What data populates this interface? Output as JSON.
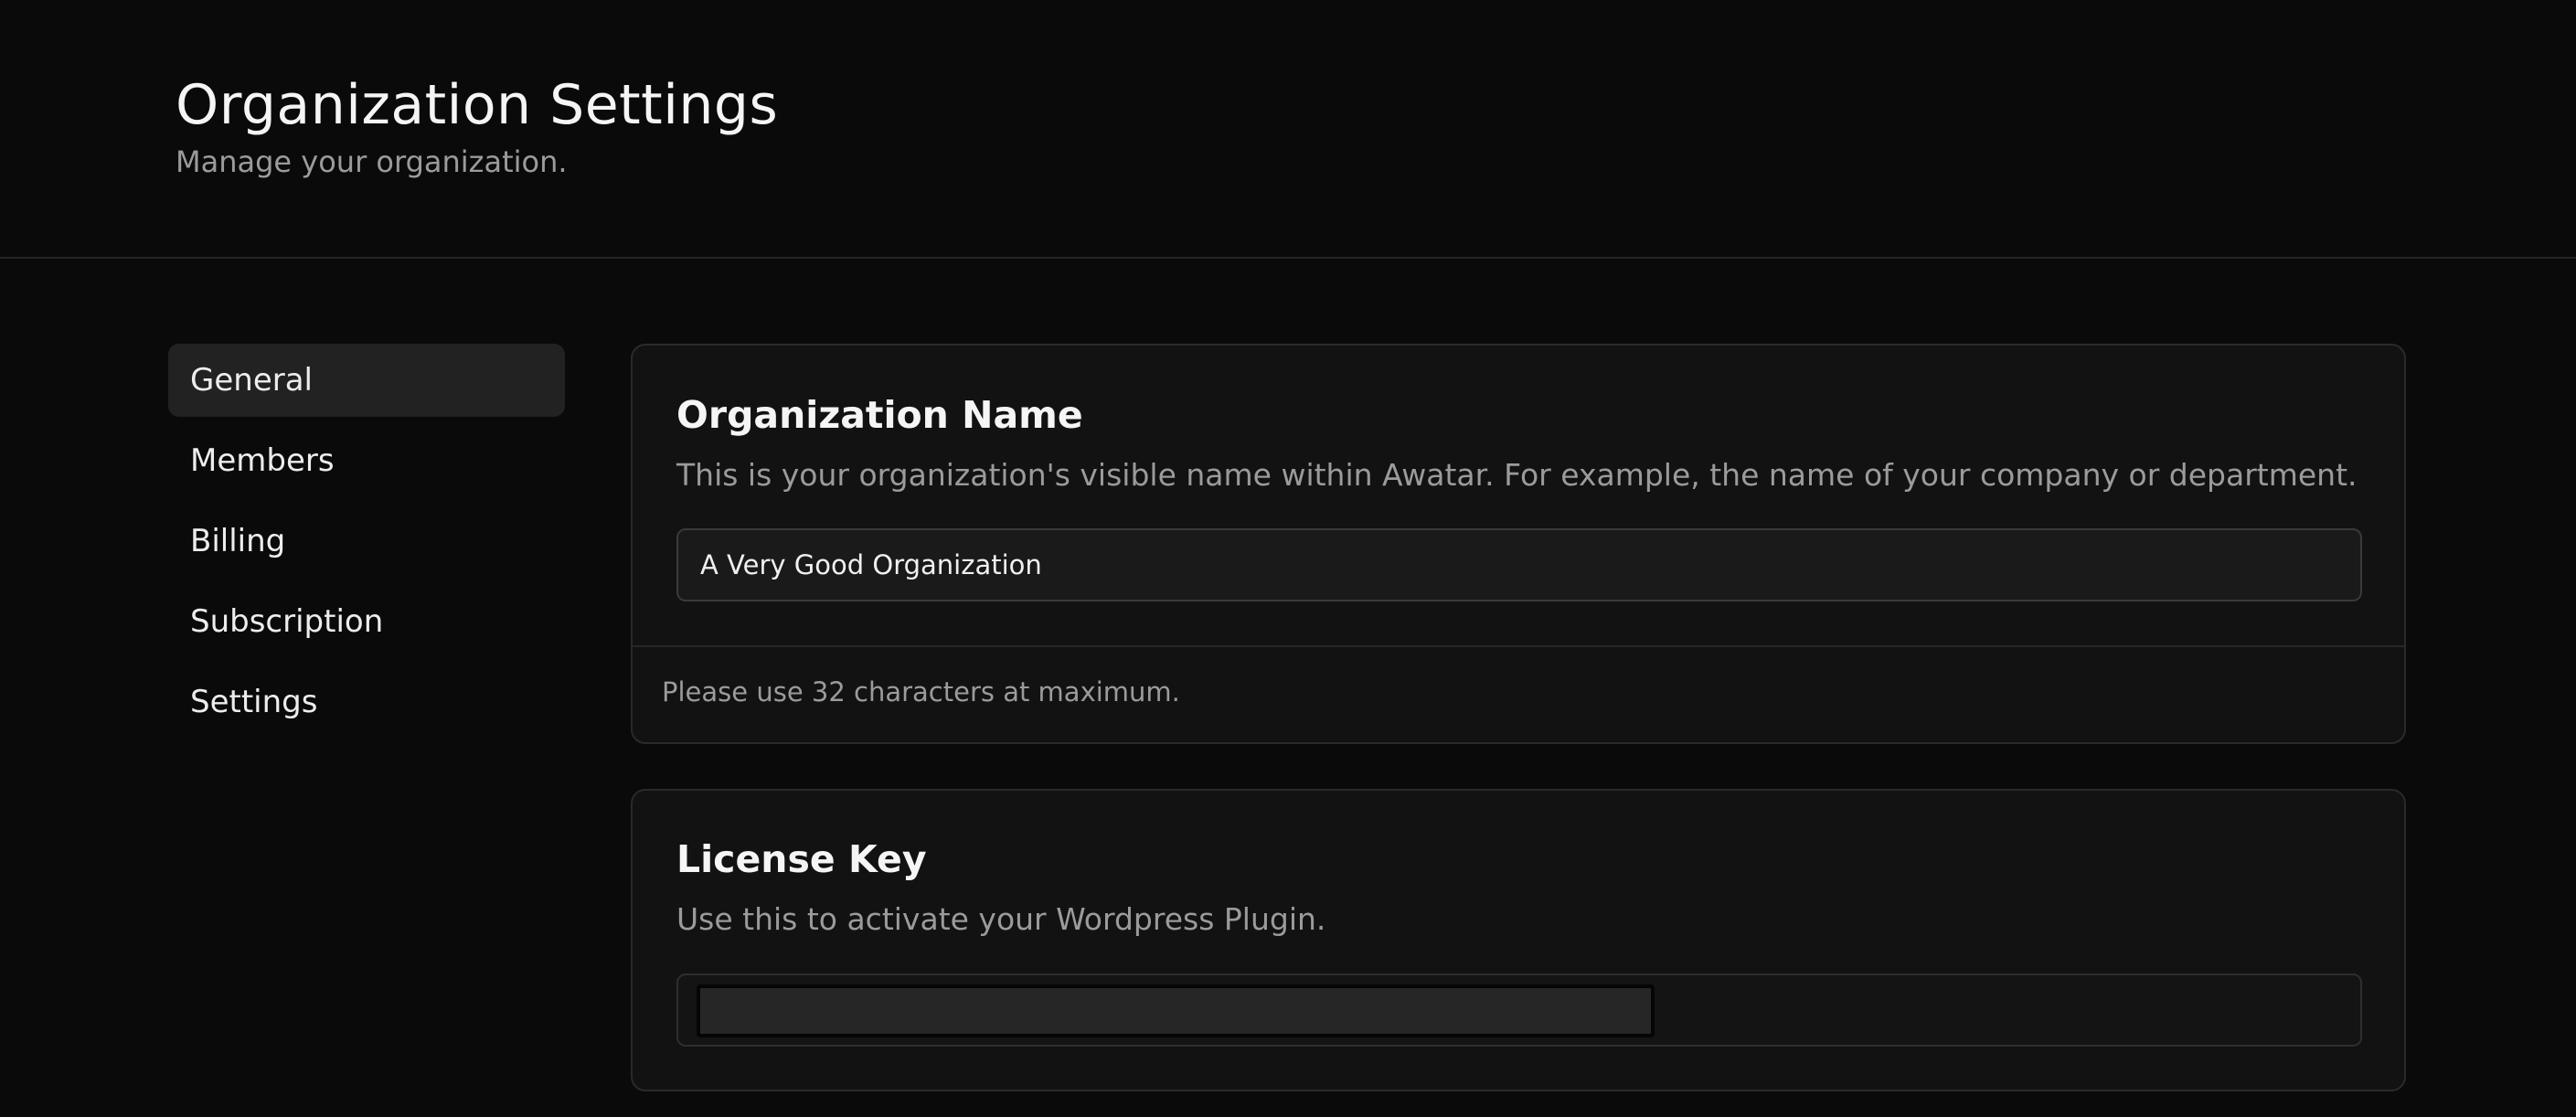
{
  "header": {
    "title": "Organization Settings",
    "subtitle": "Manage your organization."
  },
  "sidebar": {
    "items": [
      {
        "label": "General",
        "active": true
      },
      {
        "label": "Members",
        "active": false
      },
      {
        "label": "Billing",
        "active": false
      },
      {
        "label": "Subscription",
        "active": false
      },
      {
        "label": "Settings",
        "active": false
      }
    ]
  },
  "org_name_card": {
    "title": "Organization Name",
    "description": "This is your organization's visible name within Awatar. For example, the name of your company or department.",
    "input_value": "A Very Good Organization",
    "footer_hint": "Please use 32 characters at maximum."
  },
  "license_card": {
    "title": "License Key",
    "description": "Use this to activate your Wordpress Plugin.",
    "key_value": ""
  },
  "colors": {
    "background": "#0a0a0a",
    "card": "#121212",
    "active_item": "#222222",
    "muted_text": "#9b9b9b"
  }
}
